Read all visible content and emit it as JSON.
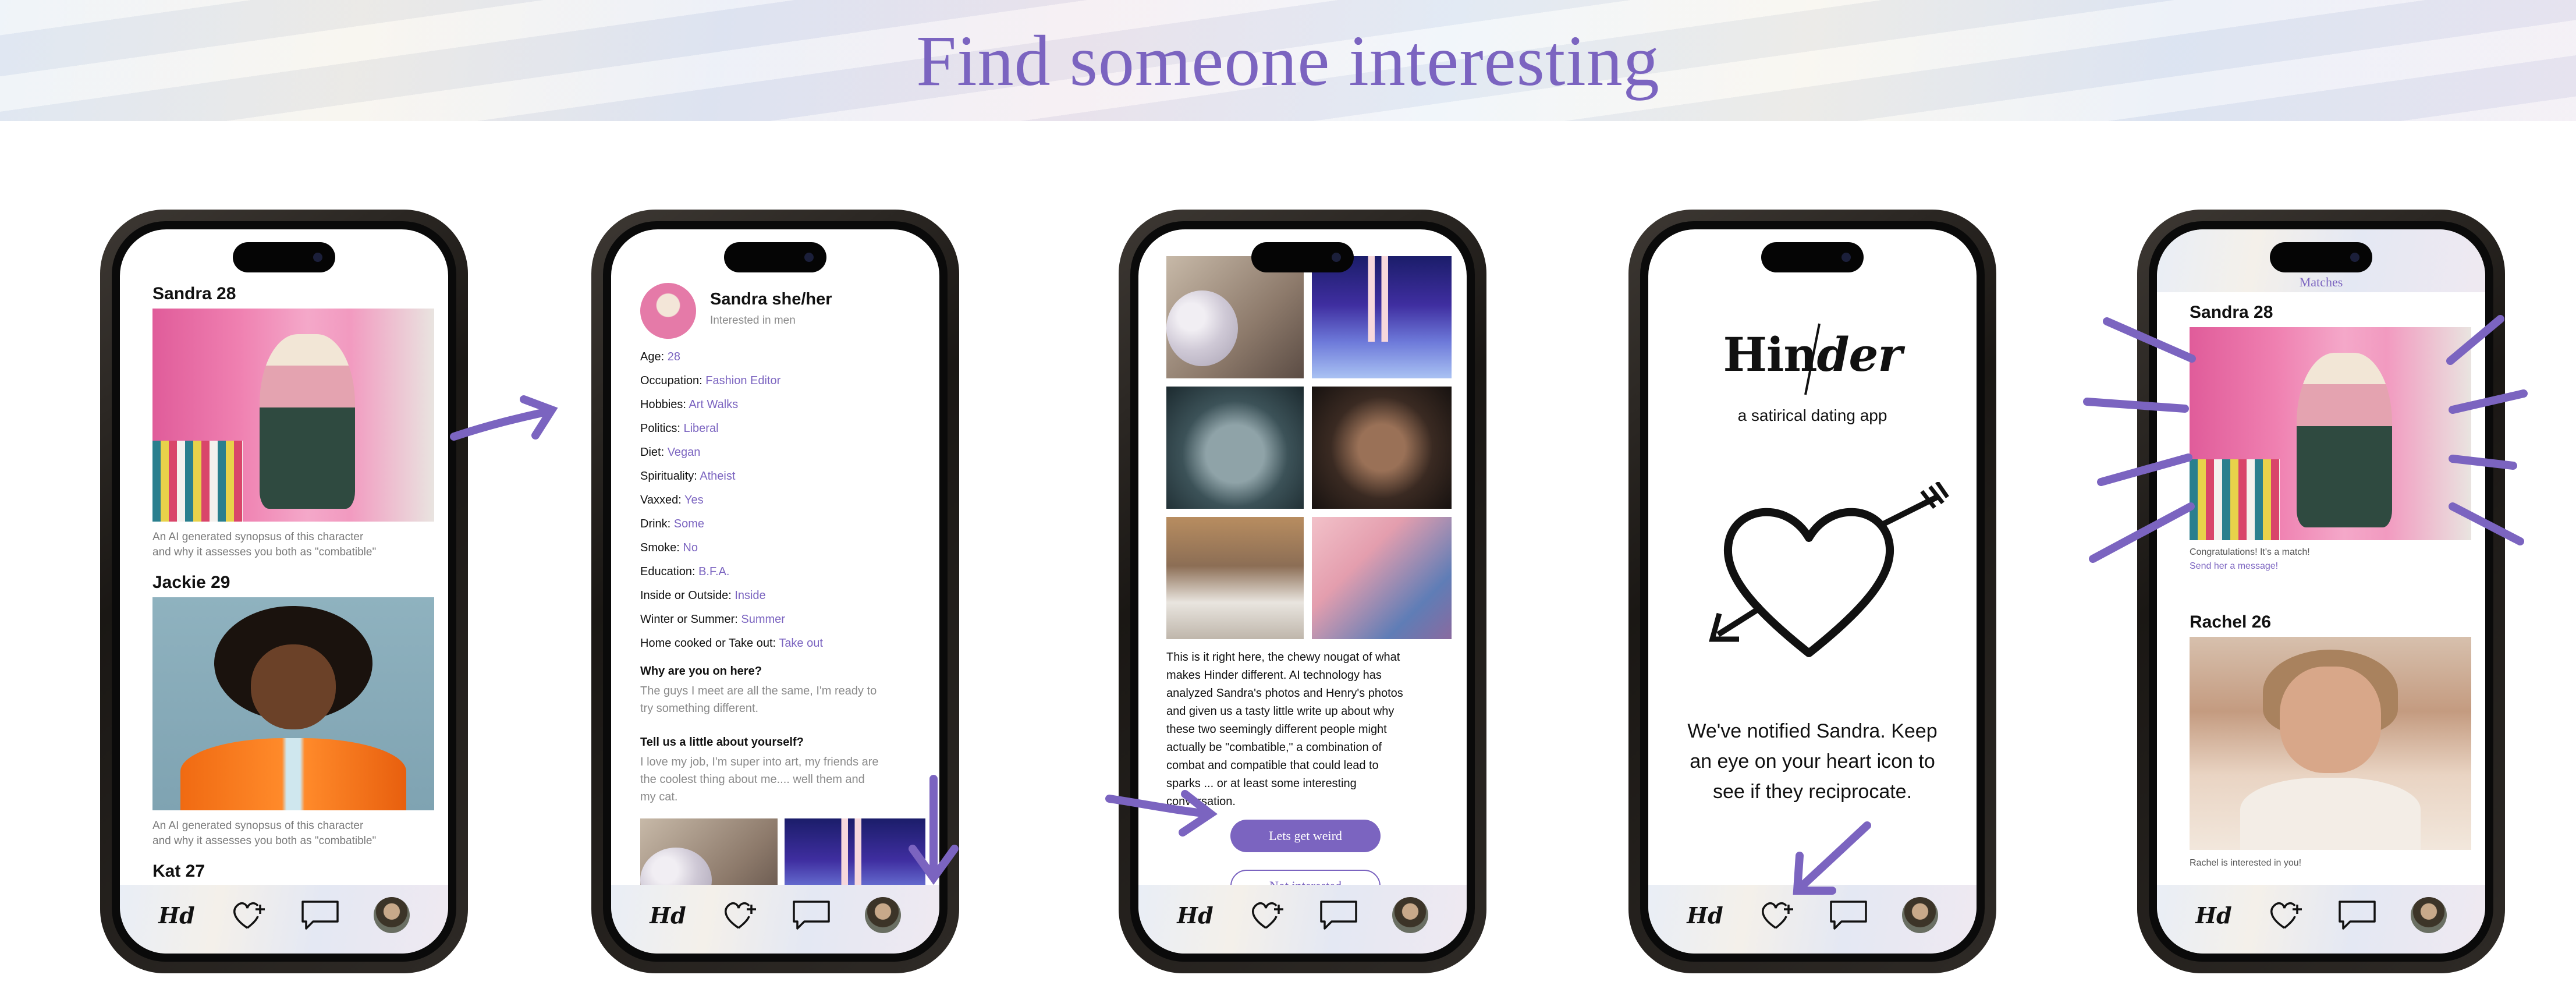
{
  "banner": {
    "title": "Find someone interesting"
  },
  "tabbar": {
    "logo": "Hd"
  },
  "phone1": {
    "profiles": [
      {
        "name": "Sandra 28",
        "synopsis_1": "An AI generated synopsus of this character",
        "synopsis_2": "and why it assesses you both as \"combatible\""
      },
      {
        "name": "Jackie 29",
        "synopsis_1": "An AI generated synopsus of this character",
        "synopsis_2": "and why it assesses you both as \"combatible\""
      },
      {
        "name": "Kat 27"
      }
    ]
  },
  "phone2": {
    "name": "Sandra she/her",
    "subtitle": "Interested in men",
    "details": [
      {
        "label": "Age:",
        "value": "28"
      },
      {
        "label": "Occupation:",
        "value": "Fashion Editor"
      },
      {
        "label": "Hobbies:",
        "value": "Art Walks"
      },
      {
        "label": "Politics:",
        "value": "Liberal"
      },
      {
        "label": "Diet:",
        "value": "Vegan"
      },
      {
        "label": "Spirituality:",
        "value": "Atheist"
      },
      {
        "label": "Vaxxed:",
        "value": "Yes"
      },
      {
        "label": "Drink:",
        "value": "Some"
      },
      {
        "label": "Smoke:",
        "value": "No"
      },
      {
        "label": "Education:",
        "value": "B.F.A."
      },
      {
        "label": "Inside or Outside:",
        "value": "Inside"
      },
      {
        "label": "Winter or Summer:",
        "value": "Summer"
      },
      {
        "label": "Home cooked or Take out:",
        "value": "Take out"
      }
    ],
    "q1": "Why are you on here?",
    "a1_lines": [
      "The guys I meet are all the same, I'm ready to",
      "try something different."
    ],
    "q2": "Tell us a little about yourself?",
    "a2_lines": [
      "I love my job, I'm super into art, my friends are",
      "the coolest thing about me.... well them and",
      "my cat."
    ]
  },
  "phone3": {
    "body_lines": [
      "This is it right here, the chewy nougat of what",
      "makes Hinder different. AI technology has",
      "analyzed Sandra's photos and Henry's photos",
      "and given us a tasty little write up about why",
      "these two seemingly different people might",
      "actually be \"combatible,\" a combination of",
      "combat and compatible that could lead to",
      "sparks ... or at least some interesting",
      "conversation."
    ],
    "primary_button": "Lets get weird",
    "secondary_button": "Not interested"
  },
  "phone4": {
    "logo_left": "Hin",
    "logo_right": "der",
    "tagline": "a satirical dating app",
    "message_lines": [
      "We've notified Sandra. Keep",
      "an eye on your heart icon to",
      "see if they reciprocate."
    ]
  },
  "phone5": {
    "header": "Matches",
    "match_1": {
      "name": "Sandra 28",
      "caption": "Congratulations! It's a match!",
      "link": "Send her a message!"
    },
    "match_2": {
      "name": "Rachel 26",
      "caption": "Rachel is interested in you!"
    }
  },
  "colors": {
    "accent": "#7b64c0",
    "text": "#111111",
    "muted": "#7a7a7a"
  },
  "icons": [
    "logo-icon",
    "heart-plus-icon",
    "chat-bubble-icon",
    "avatar"
  ]
}
